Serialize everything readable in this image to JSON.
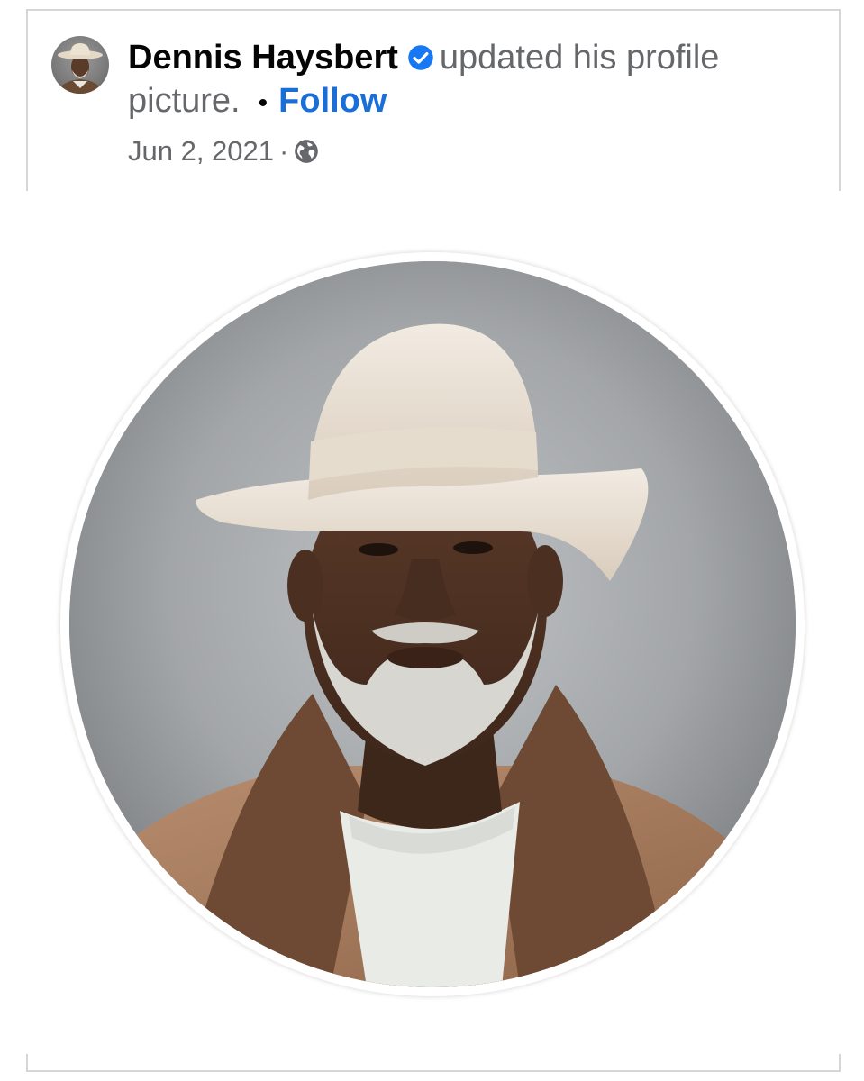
{
  "post": {
    "author": {
      "name": "Dennis Haysbert",
      "verified": true,
      "avatar_icon": "profile-avatar"
    },
    "action_text": "updated his profile picture.",
    "separator": "•",
    "follow_label": "Follow",
    "date": "Jun 2, 2021",
    "meta_separator": "·",
    "audience_icon": "globe-icon",
    "photo": {
      "shape": "circle",
      "subject": "profile-picture"
    }
  },
  "colors": {
    "follow_link": "#1a6ed8",
    "verified_badge": "#1877f2",
    "secondary_text": "#65676b",
    "primary_text": "#050505",
    "border": "#d6d6d6"
  }
}
